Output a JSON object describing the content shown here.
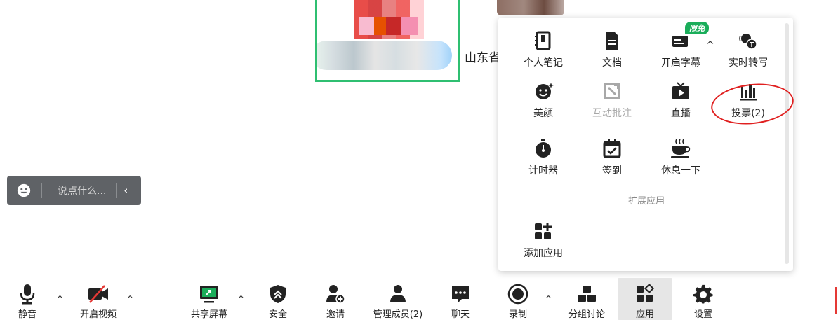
{
  "remote_participant": {
    "name": "山东省"
  },
  "chat": {
    "placeholder": "说点什么...",
    "emoji_icon": "emoji-icon",
    "collapse_glyph": "‹"
  },
  "app_panel": {
    "items": [
      {
        "label": "个人笔记",
        "icon": "notebook-icon"
      },
      {
        "label": "文档",
        "icon": "document-icon"
      },
      {
        "label": "开启字幕",
        "icon": "caption-icon",
        "badge": "限免"
      },
      {
        "label": "实时转写",
        "icon": "transcribe-icon"
      },
      {
        "label": "美颜",
        "icon": "beauty-icon"
      },
      {
        "label": "互动批注",
        "icon": "annotate-icon",
        "disabled": true
      },
      {
        "label": "直播",
        "icon": "live-icon"
      },
      {
        "label": "投票(2)",
        "icon": "vote-icon"
      },
      {
        "label": "计时器",
        "icon": "timer-icon"
      },
      {
        "label": "签到",
        "icon": "checkin-icon"
      },
      {
        "label": "休息一下",
        "icon": "coffee-icon"
      }
    ],
    "section_title": "扩展应用",
    "add_app_label": "添加应用"
  },
  "toolbar": {
    "mute": "静音",
    "video": "开启视频",
    "share": "共享屏幕",
    "security": "安全",
    "invite": "邀请",
    "members": "管理成员(2)",
    "chat": "聊天",
    "record": "录制",
    "breakout": "分组讨论",
    "apps": "应用",
    "settings": "设置"
  },
  "colors": {
    "accent_green": "#1aad5a",
    "highlight_red": "#e02020",
    "toolbar_active": "#e6e6e6"
  }
}
